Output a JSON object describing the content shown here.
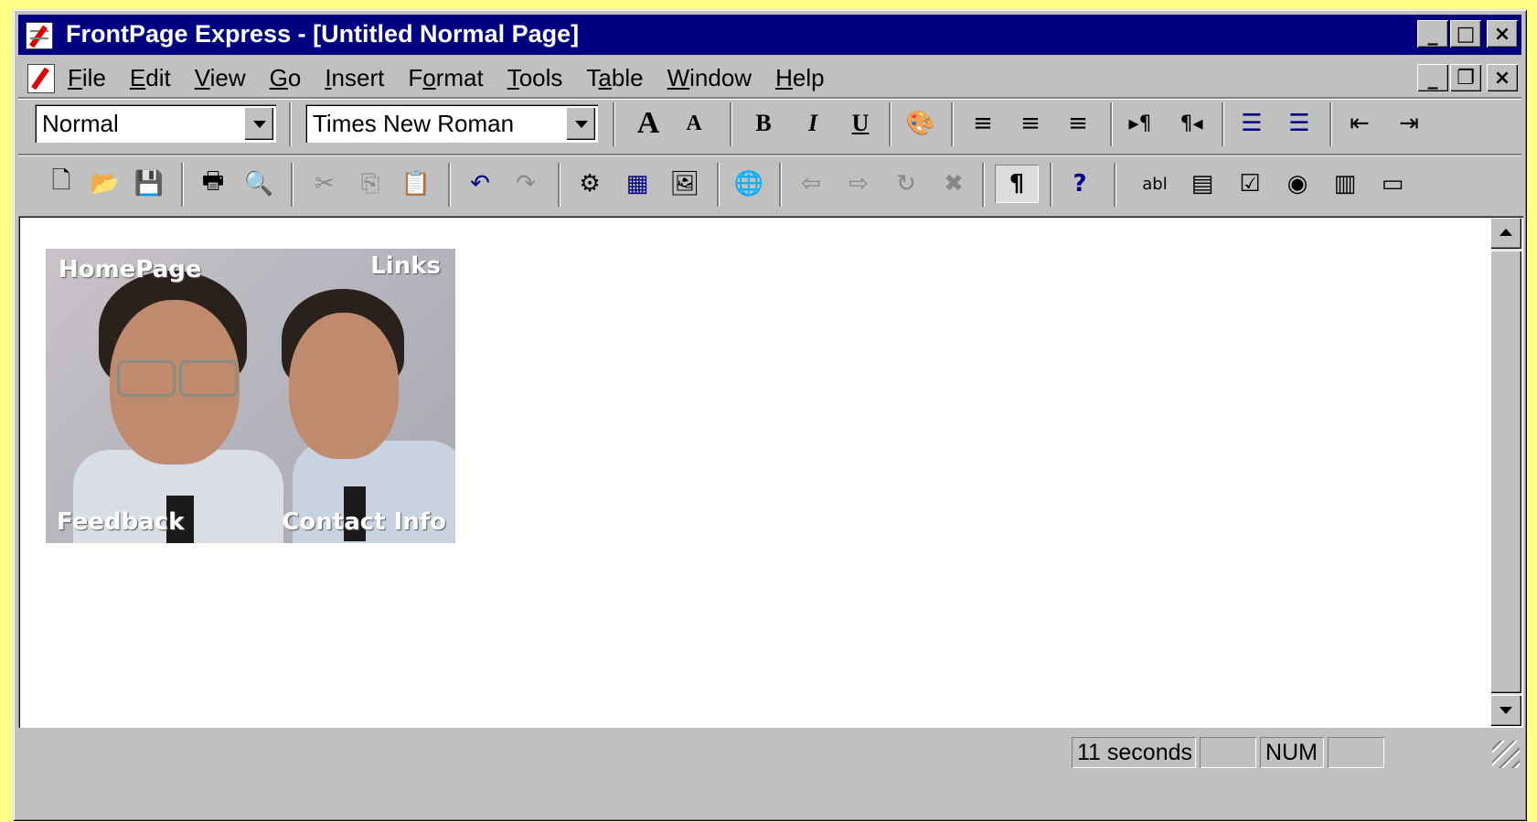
{
  "window": {
    "title": "FrontPage Express - [Untitled Normal Page]",
    "controls": {
      "minimize": "_",
      "maximize": "□",
      "close": "×"
    }
  },
  "menubar": {
    "items": [
      {
        "hot": "F",
        "rest": "ile"
      },
      {
        "hot": "E",
        "rest": "dit"
      },
      {
        "hot": "V",
        "rest": "iew"
      },
      {
        "hot": "G",
        "rest": "o"
      },
      {
        "hot": "I",
        "rest": "nsert"
      },
      {
        "pre": "F",
        "hot": "o",
        "rest": "rmat"
      },
      {
        "hot": "T",
        "rest": "ools"
      },
      {
        "pre": "T",
        "hot": "a",
        "rest": "ble"
      },
      {
        "hot": "W",
        "rest": "indow"
      },
      {
        "hot": "H",
        "rest": "elp"
      }
    ],
    "mdi_controls": {
      "minimize": "_",
      "restore": "❐",
      "close": "×"
    }
  },
  "format_toolbar": {
    "style_value": "Normal",
    "font_value": "Times New Roman",
    "icons": {
      "increase_font": "A",
      "decrease_font": "A",
      "bold": "B",
      "italic": "I",
      "underline": "U",
      "text_color": "🎨",
      "align_left": "≡",
      "align_center": "≡",
      "align_right": "≡",
      "ltr": "▸¶",
      "rtl": "¶◂",
      "numbered_list": "☰",
      "bulleted_list": "☰",
      "decrease_indent": "⇤",
      "increase_indent": "⇥"
    }
  },
  "standard_toolbar": {
    "icons": {
      "new": "🗋",
      "open": "📂",
      "save": "💾",
      "print": "🖶",
      "preview": "🔍",
      "cut": "✂",
      "copy": "⎘",
      "paste": "📋",
      "undo": "↶",
      "redo": "↷",
      "webbot": "⚙",
      "table": "▦",
      "image": "🖼",
      "hyperlink": "🌐",
      "back": "⇦",
      "forward": "⇨",
      "refresh": "↻",
      "stop": "✖",
      "show_marks": "¶",
      "help": "?",
      "textbox": "abl",
      "scrolltext": "▤",
      "checkbox": "☑",
      "radio": "◉",
      "dropdown": "▥",
      "pushbutton": "▭"
    }
  },
  "content": {
    "photo_labels": {
      "top_left": "HomePage",
      "top_right": "Links",
      "bottom_left": "Feedback",
      "bottom_right": "Contact Info"
    }
  },
  "status": {
    "time": "11 seconds",
    "num": "NUM"
  }
}
